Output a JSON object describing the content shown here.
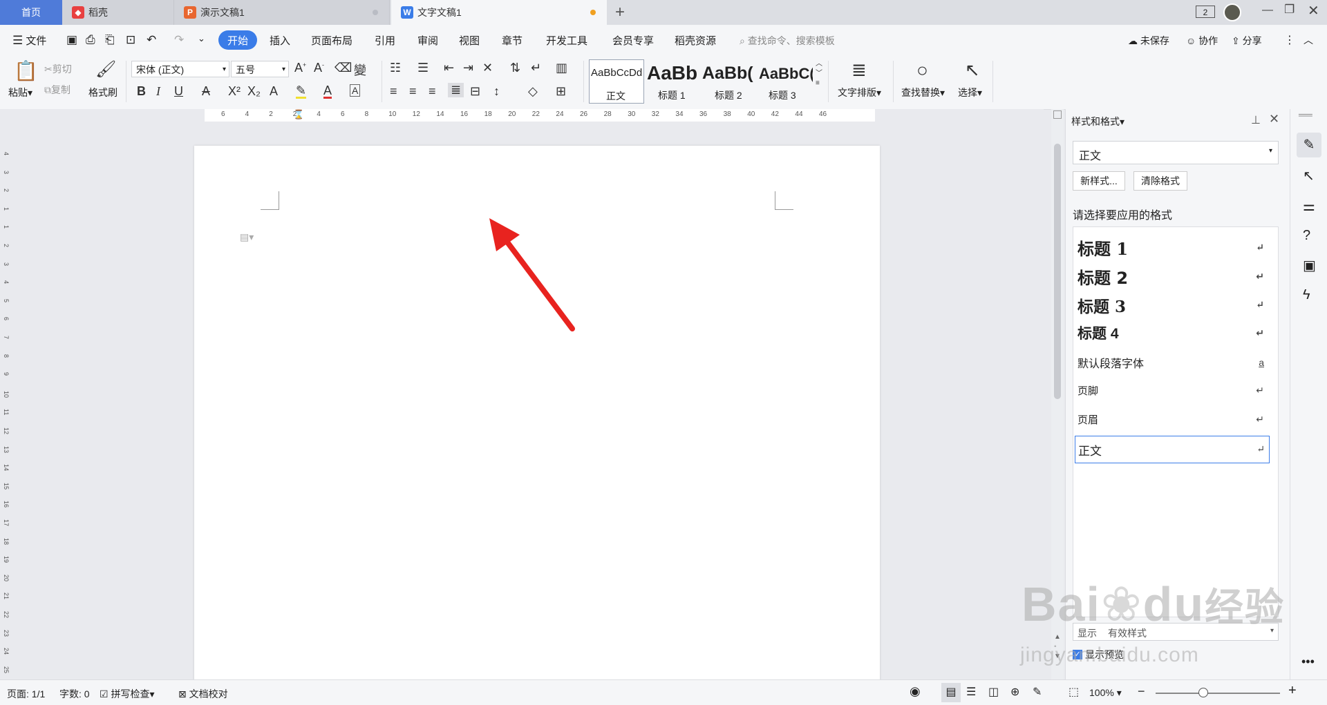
{
  "tabs": {
    "home": "首页",
    "daoke": "稻壳",
    "slides": "演示文稿1",
    "doc": "文字文稿1"
  },
  "titlebar": {
    "window_count": "2"
  },
  "menu": {
    "file": "文件",
    "start": "开始",
    "insert": "插入",
    "layout": "页面布局",
    "reference": "引用",
    "review": "审阅",
    "view": "视图",
    "chapter": "章节",
    "devtools": "开发工具",
    "member": "会员专享",
    "resources": "稻壳资源",
    "search_placeholder": "查找命令、搜索模板",
    "unsaved": "未保存",
    "collab": "协作",
    "share": "分享"
  },
  "ribbon": {
    "paste": "粘贴",
    "cut": "剪切",
    "copy": "复制",
    "format_painter": "格式刷",
    "font_name": "宋体 (正文)",
    "font_size": "五号",
    "styles": [
      {
        "preview": "AaBbCcDd",
        "name": "正文"
      },
      {
        "preview": "AaBb",
        "name": "标题 1"
      },
      {
        "preview": "AaBb(",
        "name": "标题 2"
      },
      {
        "preview": "AaBbC(",
        "name": "标题 3"
      }
    ],
    "text_layout": "文字排版",
    "find_replace": "查找替换",
    "select": "选择"
  },
  "ruler": {
    "h_ticks": [
      "6",
      "4",
      "2",
      "2",
      "4",
      "6",
      "8",
      "10",
      "12",
      "14",
      "16",
      "18",
      "20",
      "22",
      "24",
      "26",
      "28",
      "30",
      "32",
      "34",
      "36",
      "38",
      "40",
      "42",
      "44",
      "46"
    ],
    "v_ticks": [
      "4",
      "3",
      "2",
      "1",
      "1",
      "2",
      "3",
      "4",
      "5",
      "6",
      "7",
      "8",
      "9",
      "10",
      "11",
      "12",
      "13",
      "14",
      "15",
      "16",
      "17",
      "18",
      "19",
      "20",
      "21",
      "22",
      "23",
      "24",
      "25"
    ]
  },
  "panel": {
    "title": "样式和格式",
    "current_style": "正文",
    "new_style": "新样式...",
    "clear_format": "清除格式",
    "prompt": "请选择要应用的格式",
    "styles": [
      {
        "label": "标题  1",
        "mark": "↵"
      },
      {
        "label": "标题  2",
        "mark": "↵"
      },
      {
        "label": "标题  3",
        "mark": "↵"
      },
      {
        "label": "标题  4",
        "mark": "↵"
      },
      {
        "label": "默认段落字体",
        "mark": "a"
      },
      {
        "label": "页脚",
        "mark": "↵"
      },
      {
        "label": "页眉",
        "mark": "↵"
      },
      {
        "label": "正文",
        "mark": "↵"
      }
    ],
    "show_label": "显示",
    "show_value": "有效样式",
    "preview_label": "显示预览"
  },
  "status": {
    "page": "页面: 1/1",
    "words": "字数: 0",
    "spell": "拼写检查",
    "proof": "文档校对",
    "zoom": "100%"
  },
  "watermark": {
    "brand": "Bai",
    "brand2": "du",
    "cn": "经验",
    "url": "jingyan.baidu.com"
  },
  "colors": {
    "accent": "#3a7ce8",
    "home_tab": "#4f7bd9",
    "arrow": "#e8231f"
  }
}
